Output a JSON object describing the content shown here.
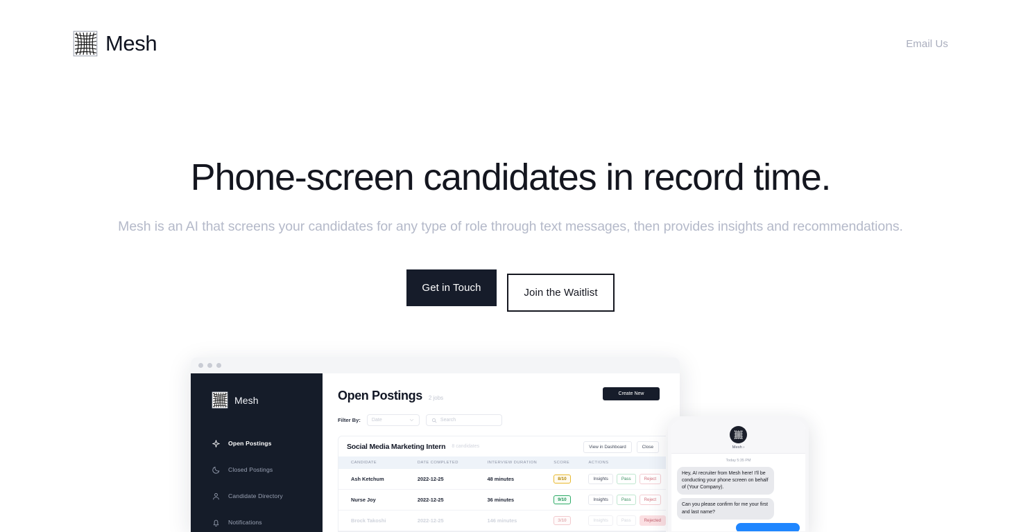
{
  "header": {
    "brand_name": "Mesh",
    "brand_icon": "mesh-grid-logo",
    "nav": {
      "email_us": "Email Us"
    }
  },
  "hero": {
    "title": "Phone-screen candidates in record time.",
    "subtitle": "Mesh is an AI that screens your candidates for any type of role through text messages, then provides insights and recommendations.",
    "primary_cta": "Get in Touch",
    "secondary_cta": "Join the Waitlist",
    "primary_cta_bg": "#161c2a"
  },
  "showcase": {
    "browser": {
      "sidebar": {
        "brand_name": "Mesh",
        "items": [
          {
            "label": "Open Postings",
            "icon": "sparkle-icon",
            "active": true
          },
          {
            "label": "Closed Postings",
            "icon": "moon-icon",
            "active": false
          },
          {
            "label": "Candidate Directory",
            "icon": "person-icon",
            "active": false
          },
          {
            "label": "Notifications",
            "icon": "bell-icon",
            "active": false
          }
        ],
        "bg": "#151c29"
      },
      "main": {
        "title": "Open Postings",
        "count": "2 jobs",
        "create_button": "Create New",
        "filter_label": "Filter By:",
        "select_value": "Date",
        "search_placeholder": "Search",
        "posting": {
          "title": "Social Media Marketing Intern",
          "candidates": "8 candidates",
          "view_button": "View in Dashboard",
          "close_button": "Close",
          "columns": [
            "CANDIDATE",
            "DATE COMPLETED",
            "INTERVIEW DURATION",
            "SCORE",
            "ACTIONS"
          ],
          "rows": [
            {
              "candidate": "Ash Ketchum",
              "date": "2022-12-25",
              "duration": "48 minutes",
              "score": "8/10",
              "score_tone": "amber",
              "dim": false,
              "actions": [
                {
                  "label": "Insights",
                  "tone": "plain"
                },
                {
                  "label": "Pass",
                  "tone": "pass"
                },
                {
                  "label": "Reject",
                  "tone": "reject"
                }
              ]
            },
            {
              "candidate": "Nurse Joy",
              "date": "2022-12-25",
              "duration": "36 minutes",
              "score": "9/10",
              "score_tone": "green",
              "dim": false,
              "actions": [
                {
                  "label": "Insights",
                  "tone": "plain"
                },
                {
                  "label": "Pass",
                  "tone": "pass"
                },
                {
                  "label": "Reject",
                  "tone": "reject"
                }
              ]
            },
            {
              "candidate": "Brock Takoshi",
              "date": "2022-12-25",
              "duration": "146 minutes",
              "score": "3/10",
              "score_tone": "red",
              "dim": true,
              "actions": [
                {
                  "label": "Insights",
                  "tone": "muted"
                },
                {
                  "label": "Pass",
                  "tone": "muted"
                },
                {
                  "label": "Rejected",
                  "tone": "rejected-fill"
                }
              ]
            }
          ]
        }
      }
    },
    "phone": {
      "contact_name": "Mesh ›",
      "timestamp": "Today 5:35 PM",
      "messages": [
        {
          "from": "mesh",
          "text": "Hey, AI recruiter from Mesh here! I'll be conducting your phone screen on behalf of (Your Company)."
        },
        {
          "from": "mesh",
          "text": "Can you please confirm for me your first and last name?"
        }
      ],
      "reply_bubble_color": "#1f86ff"
    }
  }
}
